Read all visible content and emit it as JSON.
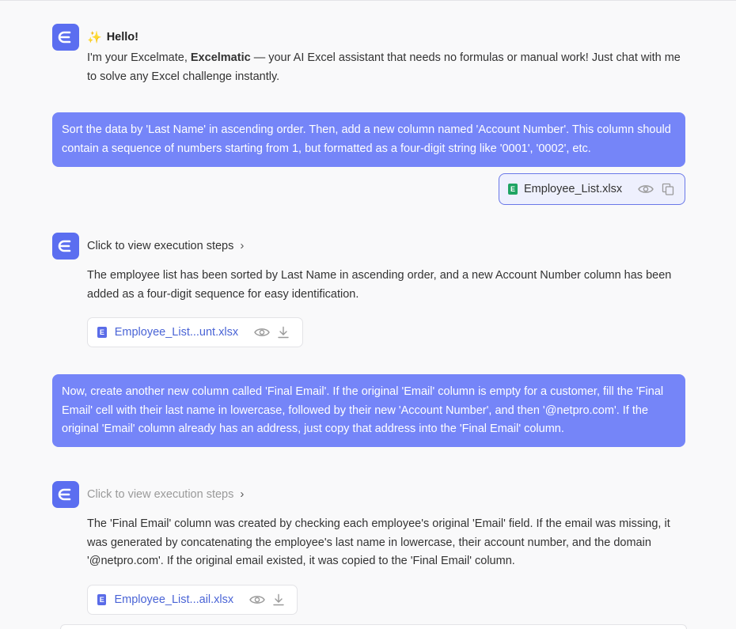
{
  "greeting": {
    "title": "Hello!",
    "intro_prefix": "I'm your Excelmate, ",
    "brand": "Excelmatic",
    "intro_suffix": " — your AI Excel assistant that needs no formulas or manual work! Just chat with me to solve any Excel challenge instantly."
  },
  "messages": {
    "user1": "Sort the data by 'Last Name' in ascending order. Then, add a new column named 'Account Number'. This column should contain a sequence of numbers starting from 1, but formatted as a four-digit string like '0001', '0002', etc.",
    "user1_attachment": "Employee_List.xlsx",
    "bot1_steps": "Click to view execution steps",
    "bot1_text": "The employee list has been sorted by Last Name in ascending order, and a new Account Number column has been added as a four-digit sequence for easy identification.",
    "bot1_file": "Employee_List...unt.xlsx",
    "user2": "Now, create another new column called 'Final Email'. If the original 'Email' column is empty for a customer, fill the 'Final Email' cell with their last name in lowercase, followed by their new 'Account Number', and then '@netpro.com'. If the original 'Email' column already has an address, just copy that address into the 'Final Email' column.",
    "bot2_steps": "Click to view execution steps",
    "bot2_text": "The 'Final Email' column was created by checking each employee's original 'Email' field. If the email was missing, it was generated by concatenating the employee's last name in lowercase, their account number, and the domain '@netpro.com'. If the original email existed, it was copied to the 'Final Email' column.",
    "bot2_file": "Employee_List...ail.xlsx"
  },
  "icons": {
    "avatar": "excelmatic-logo-icon",
    "sparkle": "sparkle-icon",
    "excel": "excel-file-icon",
    "eye": "eye-icon",
    "copy": "copy-icon",
    "download": "download-icon",
    "chevron": "chevron-right-icon"
  },
  "colors": {
    "accent": "#5b6ef0",
    "user_bubble": "#7585f8",
    "file_link": "#4a64d6",
    "excel_green": "#1fa463"
  }
}
